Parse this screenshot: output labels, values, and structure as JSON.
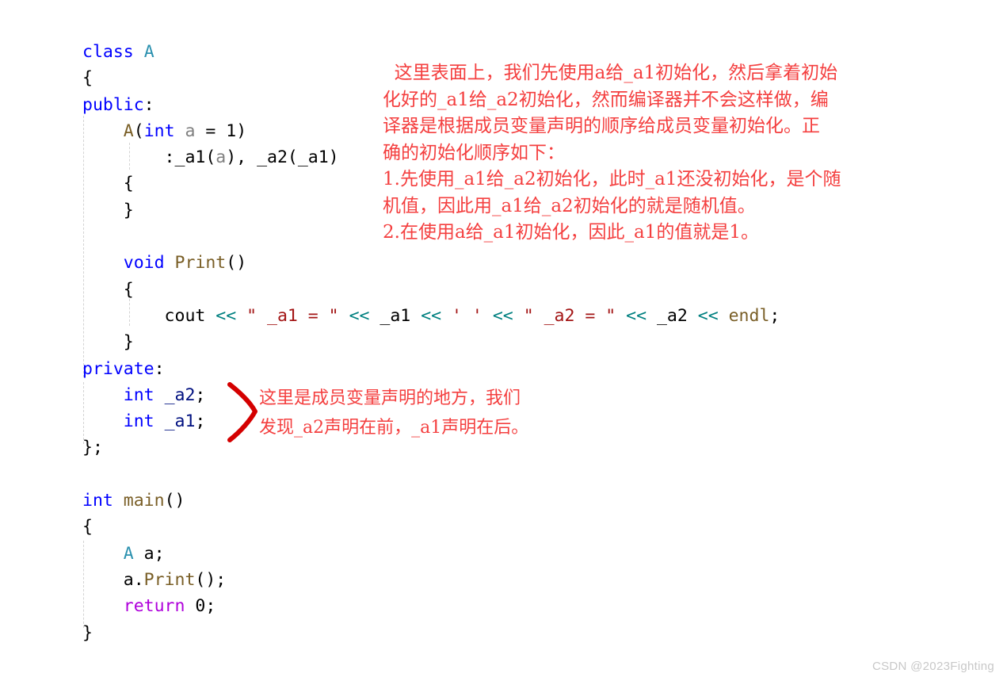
{
  "code": {
    "language": "cpp",
    "font_size_px": 21.5,
    "lines": [
      [
        {
          "t": "class",
          "c": "kw"
        },
        {
          "t": " ",
          "c": "plain"
        },
        {
          "t": "A",
          "c": "type"
        }
      ],
      [
        {
          "t": "{",
          "c": "plain"
        }
      ],
      [
        {
          "t": "public",
          "c": "kw"
        },
        {
          "t": ":",
          "c": "plain"
        }
      ],
      [
        {
          "t": "    ",
          "c": "plain"
        },
        {
          "t": "A",
          "c": "fn"
        },
        {
          "t": "(",
          "c": "plain"
        },
        {
          "t": "int",
          "c": "kw"
        },
        {
          "t": " ",
          "c": "plain"
        },
        {
          "t": "a",
          "c": "param"
        },
        {
          "t": " = 1)",
          "c": "plain"
        }
      ],
      [
        {
          "t": "        :_a1(",
          "c": "plain"
        },
        {
          "t": "a",
          "c": "param"
        },
        {
          "t": "), _a2(_a1)",
          "c": "plain"
        }
      ],
      [
        {
          "t": "    {",
          "c": "plain"
        }
      ],
      [
        {
          "t": "    }",
          "c": "plain"
        }
      ],
      [
        {
          "t": "",
          "c": "plain"
        }
      ],
      [
        {
          "t": "    ",
          "c": "plain"
        },
        {
          "t": "void",
          "c": "kw"
        },
        {
          "t": " ",
          "c": "plain"
        },
        {
          "t": "Print",
          "c": "fn"
        },
        {
          "t": "()",
          "c": "plain"
        }
      ],
      [
        {
          "t": "    {",
          "c": "plain"
        }
      ],
      [
        {
          "t": "        cout ",
          "c": "plain"
        },
        {
          "t": "<<",
          "c": "op"
        },
        {
          "t": " ",
          "c": "plain"
        },
        {
          "t": "\" _a1 = \"",
          "c": "str"
        },
        {
          "t": " ",
          "c": "plain"
        },
        {
          "t": "<<",
          "c": "op"
        },
        {
          "t": " _a1 ",
          "c": "plain"
        },
        {
          "t": "<<",
          "c": "op"
        },
        {
          "t": " ",
          "c": "plain"
        },
        {
          "t": "' '",
          "c": "str"
        },
        {
          "t": " ",
          "c": "plain"
        },
        {
          "t": "<<",
          "c": "op"
        },
        {
          "t": " ",
          "c": "plain"
        },
        {
          "t": "\" _a2 = \"",
          "c": "str"
        },
        {
          "t": " ",
          "c": "plain"
        },
        {
          "t": "<<",
          "c": "op"
        },
        {
          "t": " _a2 ",
          "c": "plain"
        },
        {
          "t": "<<",
          "c": "op"
        },
        {
          "t": " ",
          "c": "plain"
        },
        {
          "t": "endl",
          "c": "fn"
        },
        {
          "t": ";",
          "c": "plain"
        }
      ],
      [
        {
          "t": "    }",
          "c": "plain"
        }
      ],
      [
        {
          "t": "private",
          "c": "kw"
        },
        {
          "t": ":",
          "c": "plain"
        }
      ],
      [
        {
          "t": "    ",
          "c": "plain"
        },
        {
          "t": "int",
          "c": "kw"
        },
        {
          "t": " ",
          "c": "plain"
        },
        {
          "t": "_a2",
          "c": "var"
        },
        {
          "t": ";",
          "c": "plain"
        }
      ],
      [
        {
          "t": "    ",
          "c": "plain"
        },
        {
          "t": "int",
          "c": "kw"
        },
        {
          "t": " ",
          "c": "plain"
        },
        {
          "t": "_a1",
          "c": "var"
        },
        {
          "t": ";",
          "c": "plain"
        }
      ],
      [
        {
          "t": "};",
          "c": "plain"
        }
      ],
      [
        {
          "t": "",
          "c": "plain"
        }
      ],
      [
        {
          "t": "int",
          "c": "kw"
        },
        {
          "t": " ",
          "c": "plain"
        },
        {
          "t": "main",
          "c": "fn"
        },
        {
          "t": "()",
          "c": "plain"
        }
      ],
      [
        {
          "t": "{",
          "c": "plain"
        }
      ],
      [
        {
          "t": "    ",
          "c": "plain"
        },
        {
          "t": "A",
          "c": "type"
        },
        {
          "t": " a;",
          "c": "plain"
        }
      ],
      [
        {
          "t": "    a.",
          "c": "plain"
        },
        {
          "t": "Print",
          "c": "fn"
        },
        {
          "t": "();",
          "c": "plain"
        }
      ],
      [
        {
          "t": "    ",
          "c": "plain"
        },
        {
          "t": "return",
          "c": "ret"
        },
        {
          "t": " 0;",
          "c": "plain"
        }
      ],
      [
        {
          "t": "}",
          "c": "plain"
        }
      ]
    ]
  },
  "annotations": {
    "color": "#f43f3f",
    "top_note": "  这里表面上，我们先使用a给_a1初始化，然后拿着初始\n化好的_a1给_a2初始化，然而编译器并不会这样做，编\n译器是根据成员变量声明的顺序给成员变量初始化。正\n确的初始化顺序如下：\n1.先使用_a1给_a2初始化，此时_a1还没初始化，是个随\n机值，因此用_a1给_a2初始化的就是随机值。\n2.在使用a给_a1初始化，因此_a1的值就是1。",
    "side_note": "这里是成员变量声明的地方，我们\n发现_a2声明在前，_a1声明在后。",
    "brace_mark": "red-hand-drawn-closing-brace"
  },
  "watermark": {
    "text": "CSDN @2023Fighting"
  }
}
